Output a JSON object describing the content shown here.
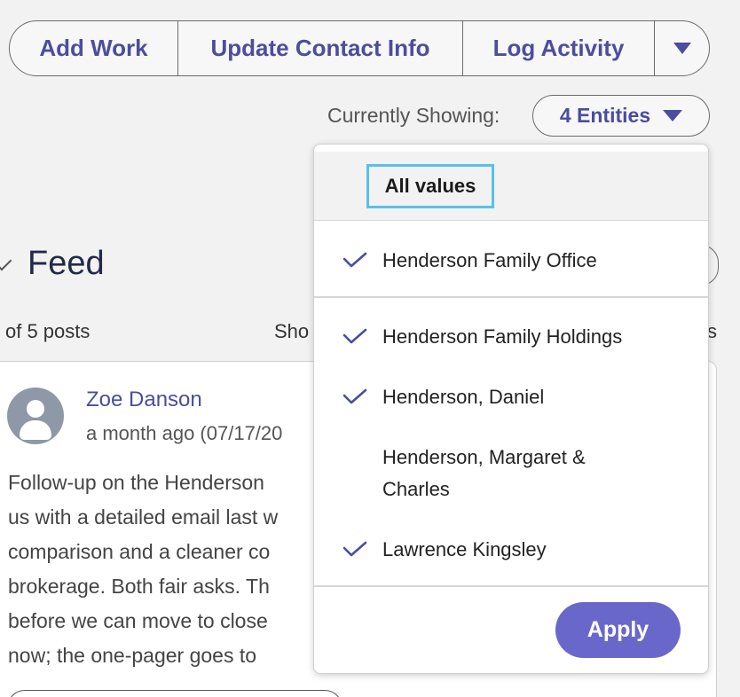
{
  "toolbar": {
    "add_work": "Add Work",
    "update_contact": "Update Contact Info",
    "log_activity": "Log Activity"
  },
  "filter": {
    "label": "Currently Showing:",
    "value": "4 Entities"
  },
  "feed": {
    "title": "Feed",
    "count": "of 5 posts",
    "show_partial": "Sho",
    "right_partial": "s"
  },
  "post": {
    "author": "Zoe Danson",
    "time": "a month ago (07/17/20",
    "lines": [
      "Follow-up on the Henderson",
      "us with a detailed email last w",
      "comparison and a cleaner co",
      "brokerage. Both fair asks. Th",
      "before we can move to close",
      "now; the one-pager goes to"
    ]
  },
  "dropdown": {
    "all_values": "All values",
    "items": [
      {
        "label": "Henderson Family Office",
        "checked": true
      },
      {
        "label": "Henderson Family Holdings",
        "checked": true
      },
      {
        "label": "Henderson, Daniel",
        "checked": true
      },
      {
        "label": "Henderson, Margaret & Charles",
        "checked": false
      },
      {
        "label": "Lawrence Kingsley",
        "checked": true
      }
    ],
    "apply": "Apply"
  },
  "colors": {
    "accent": "#4b4d9e",
    "apply_bg": "#6a67cb",
    "focus_ring": "#56c1ea",
    "check": "#4b4d9e"
  },
  "icons": {
    "more": "caret-down-icon",
    "entities": "caret-down-icon",
    "check": "check-icon",
    "avatar": "user-avatar-icon",
    "feed_toggle": "chevron-icon"
  }
}
